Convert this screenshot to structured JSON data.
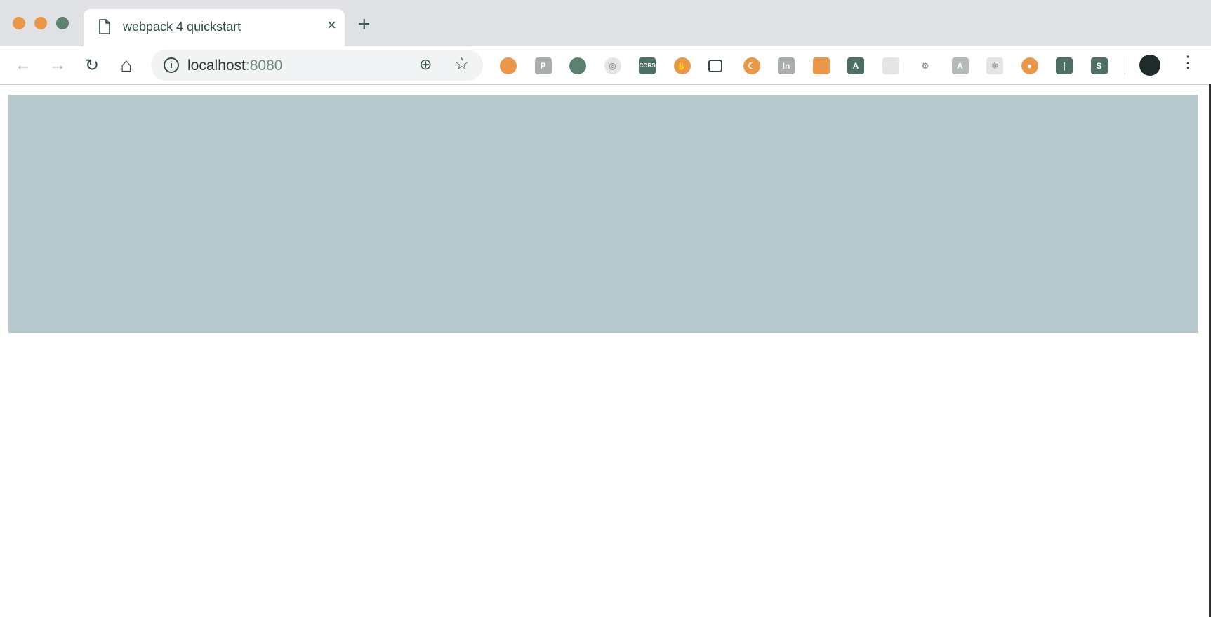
{
  "window": {
    "traffic_lights": [
      "#e9984a",
      "#e9984a",
      "#5b8270"
    ]
  },
  "tab": {
    "title": "webpack 4 quickstart",
    "close": "×"
  },
  "new_tab": "+",
  "toolbar": {
    "back": "←",
    "forward": "→",
    "reload": "↻",
    "home": "⌂",
    "menu": "⋮"
  },
  "omnibox": {
    "host": "localhost",
    "port": ":8080",
    "info": "i",
    "zoom": "⊕",
    "star": "☆"
  },
  "extensions": [
    {
      "name": "color-picker",
      "label": "",
      "color": "#e9984a"
    },
    {
      "name": "p-ext",
      "label": "P",
      "color": "#a9aeab"
    },
    {
      "name": "chat",
      "label": "",
      "color": "#5b8270"
    },
    {
      "name": "target",
      "label": "◎",
      "color": "#e3e6e5"
    },
    {
      "name": "cors",
      "label": "CORS",
      "color": "#4e6f63"
    },
    {
      "name": "hand",
      "label": "✋",
      "color": "#e9984a"
    },
    {
      "name": "cast",
      "label": "",
      "color": "#ffffff"
    },
    {
      "name": "moon",
      "label": "☾",
      "color": "#e9984a"
    },
    {
      "name": "in",
      "label": "In",
      "color": "#a9aeab"
    },
    {
      "name": "android",
      "label": "",
      "color": "#e9984a"
    },
    {
      "name": "angular",
      "label": "A",
      "color": "#4e6f63"
    },
    {
      "name": "window",
      "label": "",
      "color": "#e3e6e5"
    },
    {
      "name": "gear",
      "label": "⚙",
      "color": "#ffffff"
    },
    {
      "name": "angular-gray",
      "label": "A",
      "color": "#b4bbb8"
    },
    {
      "name": "react",
      "label": "⚛",
      "color": "#e3e6e5"
    },
    {
      "name": "eye",
      "label": "●",
      "color": "#e9984a"
    },
    {
      "name": "bar",
      "label": "|",
      "color": "#4e6f63"
    },
    {
      "name": "s-ext",
      "label": "S",
      "color": "#4e6f63"
    }
  ],
  "content": {
    "box_color": "#b7c9cd"
  }
}
